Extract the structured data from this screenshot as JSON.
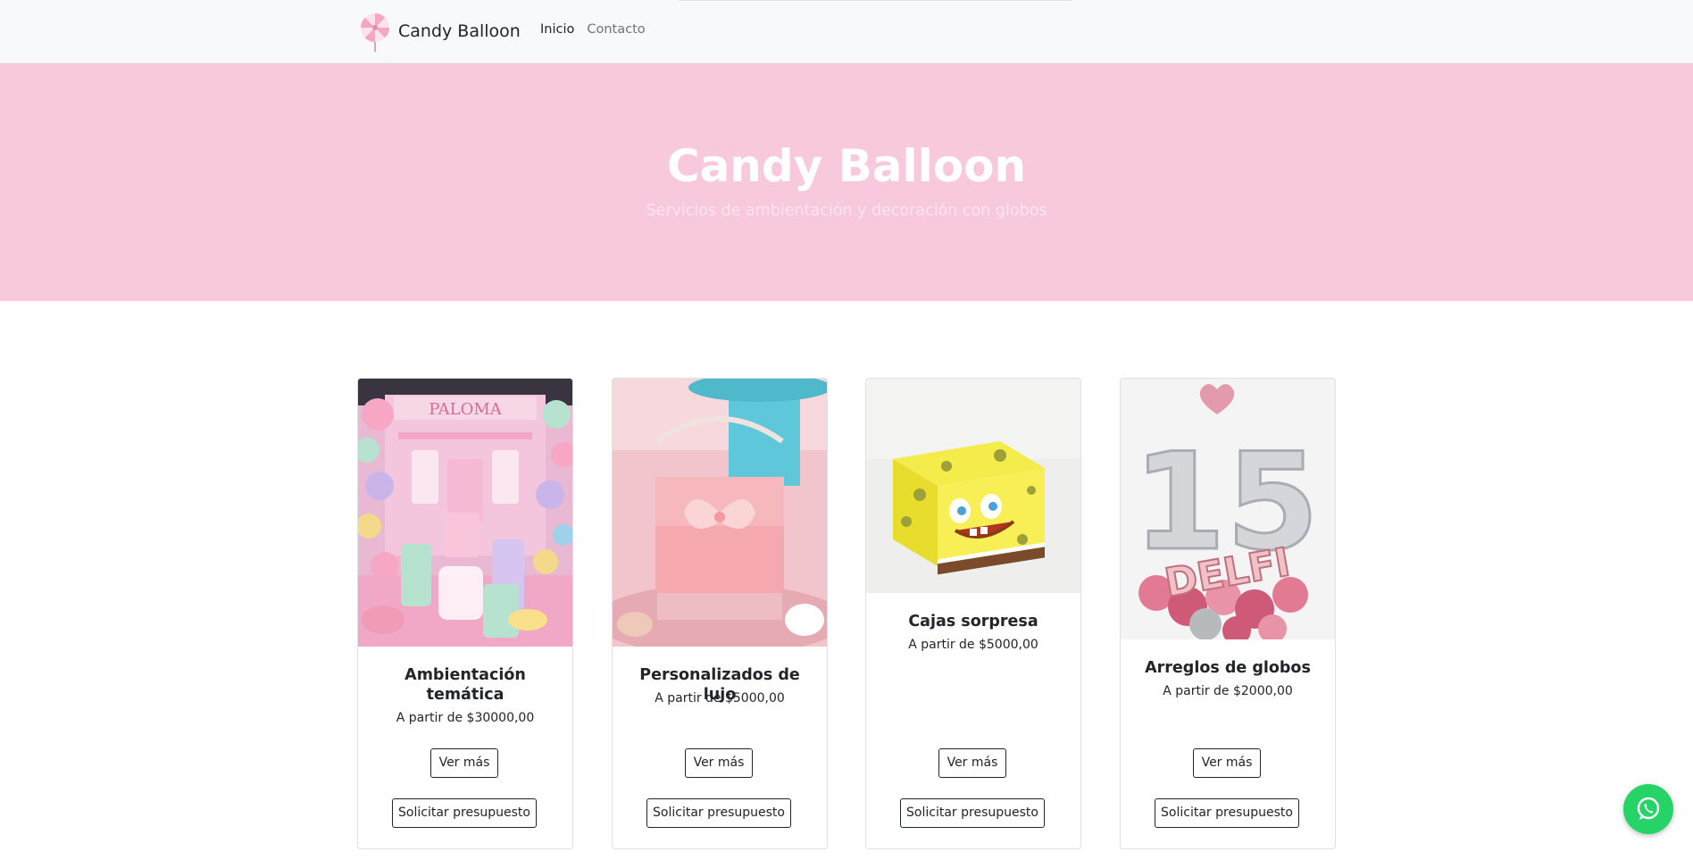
{
  "nav": {
    "brand": "Candy Balloon",
    "links": [
      {
        "label": "Inicio",
        "active": true
      },
      {
        "label": "Contacto",
        "active": false
      }
    ]
  },
  "hero": {
    "title": "Candy Balloon",
    "subtitle": "Servicios de ambientación y decoración con globos"
  },
  "cards": [
    {
      "title": "Ambientación temática",
      "price": "A partir de $30000,00",
      "more": "Ver más",
      "quote": "Solicitar presupuesto",
      "image": "party-table-paloma"
    },
    {
      "title": "Personalizados de lujo",
      "price": "A partir de $5000,00",
      "more": "Ver más",
      "quote": "Solicitar presupuesto",
      "image": "pink-gift-bag"
    },
    {
      "title": "Cajas sorpresa",
      "price": "A partir de $5000,00",
      "more": "Ver más",
      "quote": "Solicitar presupuesto",
      "image": "spongebob-box"
    },
    {
      "title": "Arreglos de globos",
      "price": "A partir de $2000,00",
      "more": "Ver más",
      "quote": "Solicitar presupuesto",
      "image": "balloon-15-delfi"
    }
  ],
  "image_text": {
    "card1_sign": "PALOMA",
    "card4_number": "15",
    "card4_name": "DELFI"
  },
  "colors": {
    "hero_bg": "#f8c8dc",
    "navbar_bg": "#f8f9fa",
    "whatsapp": "#25d366"
  },
  "floating": {
    "icon": "whatsapp-icon"
  }
}
